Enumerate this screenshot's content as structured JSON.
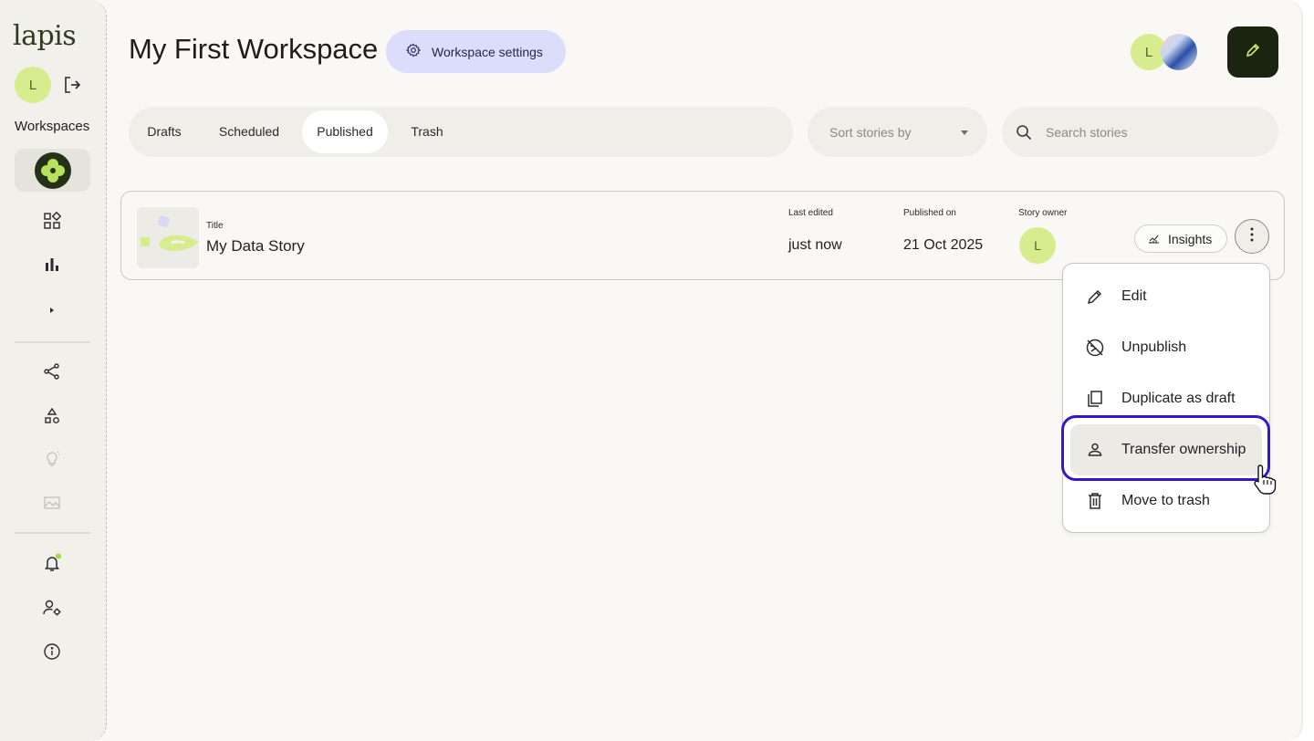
{
  "sidebar": {
    "logo": "lapis",
    "user_initial": "L",
    "workspaces_label": "Workspaces",
    "icons": [
      "dashboard-icon",
      "bar-chart-icon",
      "expand-arrow-icon",
      "share-icon",
      "shapes-icon",
      "lightbulb-icon",
      "image-edit-icon",
      "bell-icon",
      "user-settings-icon",
      "info-icon"
    ],
    "notification_dot_color": "#a6d64a"
  },
  "header": {
    "title": "My First Workspace",
    "settings_label": "Workspace settings",
    "member_initial": "L"
  },
  "filters": {
    "tabs": [
      {
        "label": "Drafts",
        "active": false
      },
      {
        "label": "Scheduled",
        "active": false
      },
      {
        "label": "Published",
        "active": true
      },
      {
        "label": "Trash",
        "active": false
      }
    ],
    "sort_placeholder": "Sort stories by",
    "search_placeholder": "Search stories"
  },
  "story": {
    "title_label": "Title",
    "title": "My Data Story",
    "last_edited_label": "Last edited",
    "last_edited": "just now",
    "published_label": "Published on",
    "published": "21 Oct 2025",
    "owner_label": "Story owner",
    "owner_initial": "L",
    "insights_label": "Insights"
  },
  "menu": {
    "items": [
      {
        "label": "Edit",
        "icon": "pencil-icon"
      },
      {
        "label": "Unpublish",
        "icon": "unpublish-icon"
      },
      {
        "label": "Duplicate as draft",
        "icon": "copy-icon"
      },
      {
        "label": "Transfer ownership",
        "icon": "person-icon",
        "highlighted": true
      },
      {
        "label": "Move to trash",
        "icon": "trash-icon"
      }
    ]
  },
  "colors": {
    "accent_green": "#d6ec8e",
    "dark_green": "#1b2410",
    "settings_bg": "#dcdcfb",
    "highlight_ring": "#3516c8"
  }
}
